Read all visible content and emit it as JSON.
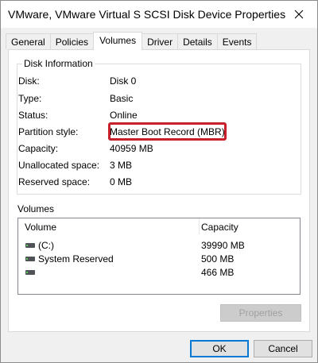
{
  "window": {
    "title": "VMware, VMware Virtual S SCSI Disk Device Properties",
    "close_icon": "close-icon"
  },
  "tabs": [
    {
      "label": "General",
      "active": false
    },
    {
      "label": "Policies",
      "active": false
    },
    {
      "label": "Volumes",
      "active": true
    },
    {
      "label": "Driver",
      "active": false
    },
    {
      "label": "Details",
      "active": false
    },
    {
      "label": "Events",
      "active": false
    }
  ],
  "disk_info": {
    "group_label": "Disk Information",
    "rows": [
      {
        "label": "Disk:",
        "value": "Disk 0"
      },
      {
        "label": "Type:",
        "value": "Basic"
      },
      {
        "label": "Status:",
        "value": "Online"
      },
      {
        "label": "Partition style:",
        "value": "Master Boot Record (MBR)"
      },
      {
        "label": "Capacity:",
        "value": "40959 MB"
      },
      {
        "label": "Unallocated space:",
        "value": "3 MB"
      },
      {
        "label": "Reserved space:",
        "value": "0 MB"
      }
    ],
    "highlight_color": "#c8202a"
  },
  "volumes": {
    "group_label": "Volumes",
    "columns": [
      "Volume",
      "Capacity"
    ],
    "rows": [
      {
        "name": "(C:)",
        "capacity": "39990 MB",
        "icon": "drive-icon"
      },
      {
        "name": "System Reserved",
        "capacity": "500 MB",
        "icon": "drive-icon"
      },
      {
        "name": "",
        "capacity": "466 MB",
        "icon": "drive-icon"
      }
    ],
    "properties_label": "Properties"
  },
  "footer": {
    "ok_label": "OK",
    "cancel_label": "Cancel"
  }
}
